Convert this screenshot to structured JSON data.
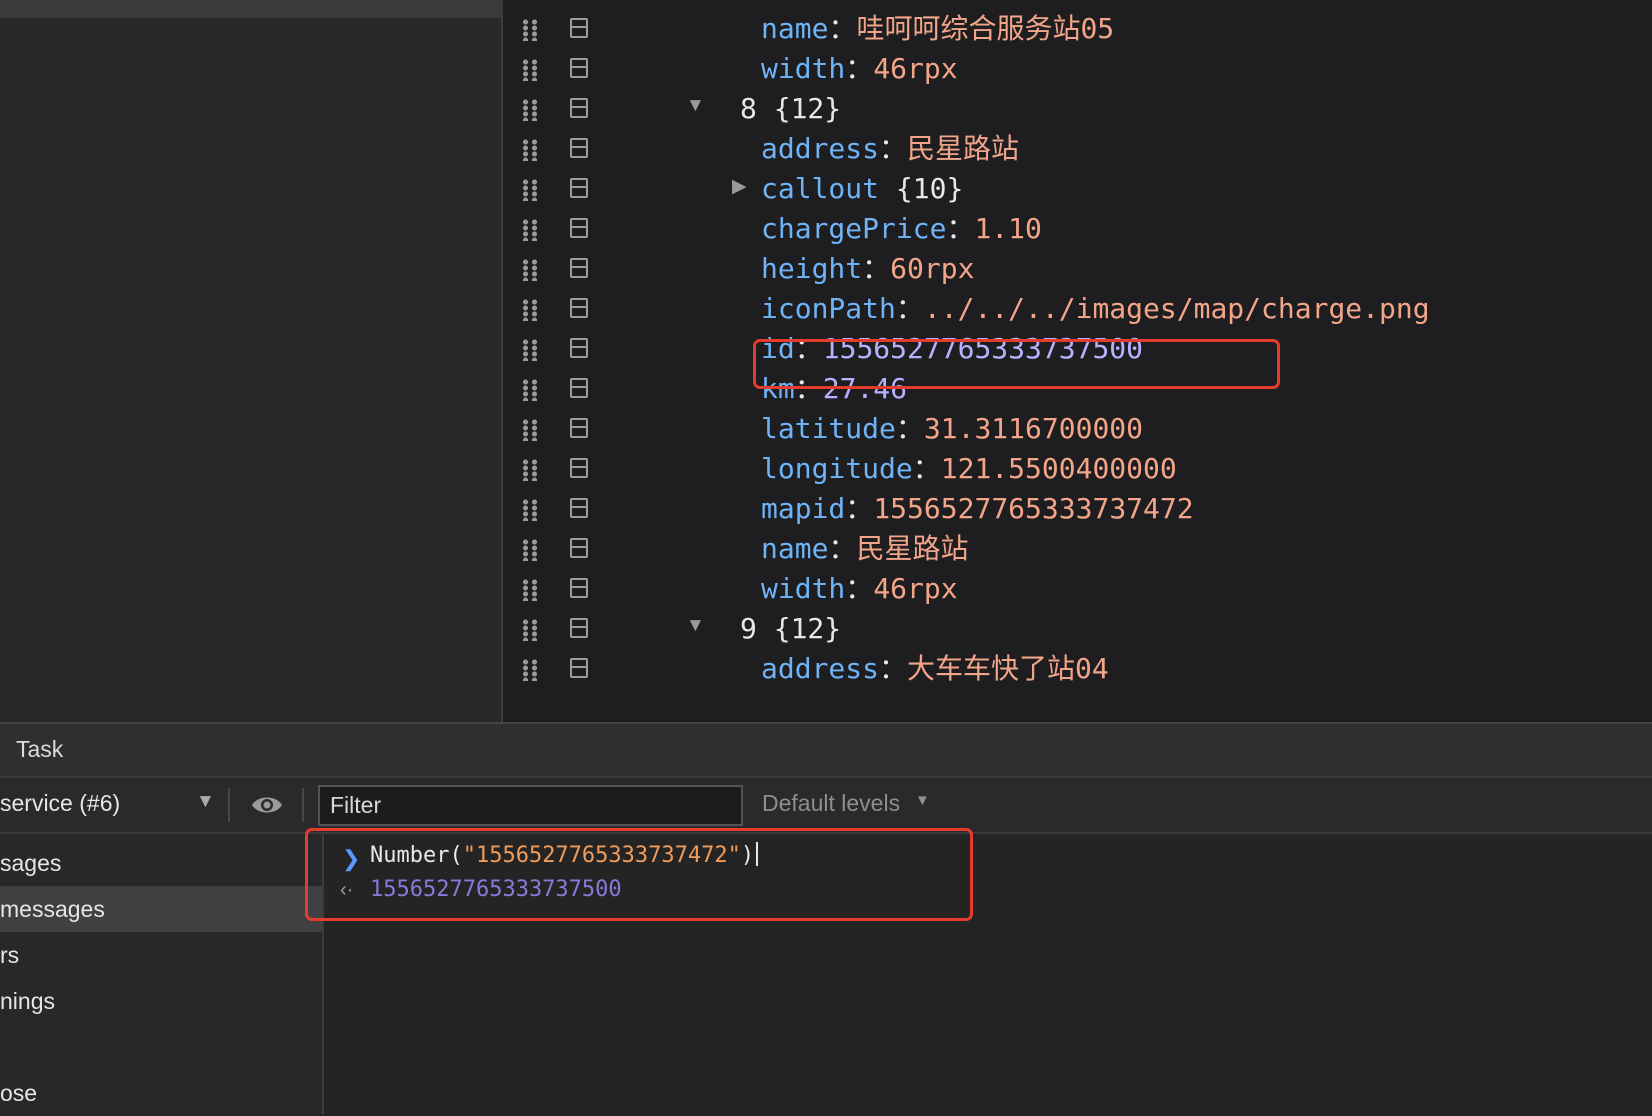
{
  "tree": [
    {
      "depth": 2,
      "key": "name",
      "value": "哇呵呵综合服务站05",
      "vtype": "str"
    },
    {
      "depth": 2,
      "key": "width",
      "value": "46rpx",
      "vtype": "str"
    },
    {
      "depth": 1,
      "toggle": "▼",
      "key": "8",
      "value": "{12}",
      "vtype": "group"
    },
    {
      "depth": 2,
      "key": "address",
      "value": "民星路站",
      "vtype": "str"
    },
    {
      "depth": 2,
      "toggle": "▶",
      "key": "callout",
      "value": "{10}",
      "vtype": "group"
    },
    {
      "depth": 2,
      "key": "chargePrice",
      "value": "1.10",
      "vtype": "str"
    },
    {
      "depth": 2,
      "key": "height",
      "value": "60rpx",
      "vtype": "str"
    },
    {
      "depth": 2,
      "key": "iconPath",
      "value": "../../../images/map/charge.png",
      "vtype": "str"
    },
    {
      "depth": 2,
      "key": "id",
      "value": "1556527765333737500",
      "vtype": "num"
    },
    {
      "depth": 2,
      "key": "km",
      "value": "27.46",
      "vtype": "num"
    },
    {
      "depth": 2,
      "key": "latitude",
      "value": "31.3116700000",
      "vtype": "str"
    },
    {
      "depth": 2,
      "key": "longitude",
      "value": "121.5500400000",
      "vtype": "str"
    },
    {
      "depth": 2,
      "key": "mapid",
      "value": "1556527765333737472",
      "vtype": "str"
    },
    {
      "depth": 2,
      "key": "name",
      "value": "民星路站",
      "vtype": "str"
    },
    {
      "depth": 2,
      "key": "width",
      "value": "46rpx",
      "vtype": "str"
    },
    {
      "depth": 1,
      "toggle": "▼",
      "key": "9",
      "value": "{12}",
      "vtype": "group"
    },
    {
      "depth": 2,
      "key": "address",
      "value": "大车车快了站04",
      "vtype": "str"
    }
  ],
  "drawer": {
    "tab_label": "Task",
    "context_selector": "service (#6)",
    "filter_placeholder": "Filter",
    "levels_label": "Default levels",
    "sidebar_items": [
      "sages",
      "messages",
      "rs",
      "nings",
      "",
      "ose"
    ],
    "selected_sidebar_index": 1,
    "console": {
      "command_fn": "Number(",
      "command_arg": "\"1556527765333737472\"",
      "command_close": ")",
      "result": "1556527765333737500"
    }
  },
  "colors": {
    "highlight": "#e63c2e",
    "key": "#6fb3f5",
    "string": "#f3a58a",
    "number": "#b5b3ff"
  }
}
